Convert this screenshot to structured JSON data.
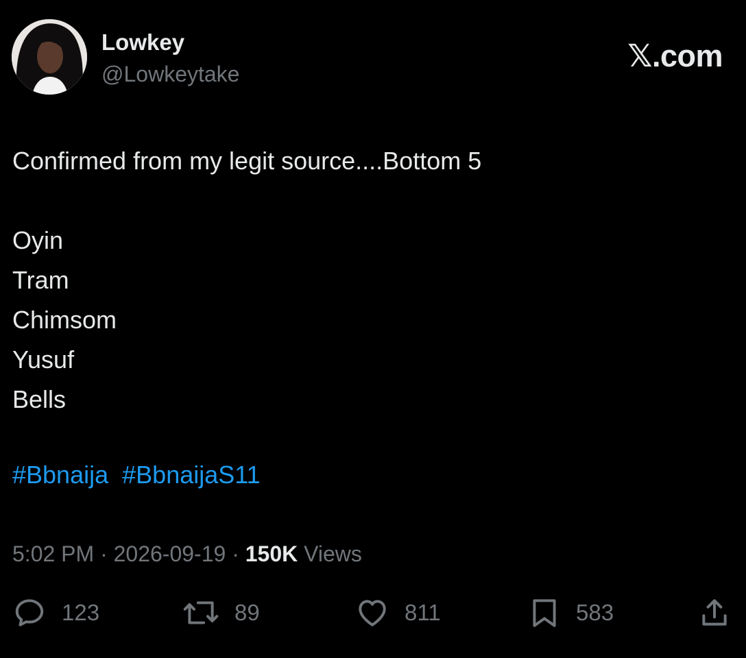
{
  "author": {
    "display_name": "Lowkey",
    "handle": "@Lowkeytake"
  },
  "brand": "𝕏.com",
  "tweet": {
    "lines": [
      "Confirmed from my legit source....Bottom 5",
      "",
      "Oyin",
      "Tram",
      "Chimsom",
      "Yusuf",
      "Bells"
    ],
    "hashtags": [
      "#Bbnaija",
      "#BbnaijaS11"
    ]
  },
  "meta": {
    "time": "5:02 PM",
    "separator": " · ",
    "date": "2026-09-19",
    "views_count": "150K",
    "views_label": "Views"
  },
  "actions": {
    "replies": "123",
    "retweets": "89",
    "likes": "811",
    "bookmarks": "583"
  },
  "icons": {
    "reply": "reply-icon",
    "retweet": "retweet-icon",
    "like": "heart-icon",
    "bookmark": "bookmark-icon",
    "share": "share-icon"
  },
  "colors": {
    "background": "#000000",
    "text": "#e7e9ea",
    "muted": "#71767b",
    "link": "#1d9bf0"
  }
}
